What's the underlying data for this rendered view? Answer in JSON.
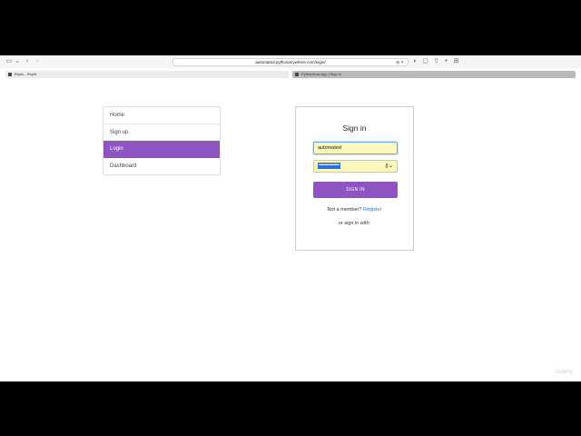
{
  "toolbar": {
    "url": "automated.pythonanywhere.com/login/"
  },
  "tabs": [
    {
      "label": "Repls - Replit"
    },
    {
      "label": "PythonHow App | Sign in"
    }
  ],
  "nav": {
    "items": [
      {
        "label": "Home"
      },
      {
        "label": "Sign up"
      },
      {
        "label": "Login"
      },
      {
        "label": "Dashboard"
      }
    ],
    "active": "Login"
  },
  "signin": {
    "title": "Sign in",
    "username_value": "automated",
    "password_masked": "••••••••••••••••••",
    "submit_label": "SIGN IN",
    "not_member_text": "Not a member?",
    "register_link": "Register",
    "or_text": "or sign in with:"
  },
  "watermark": "Udemy",
  "colors": {
    "accent": "#8e54c1",
    "autofill": "#fbf8bd",
    "link": "#2e74c9"
  }
}
